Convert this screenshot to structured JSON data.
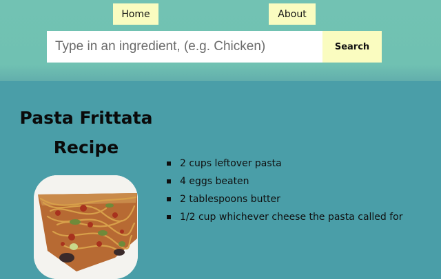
{
  "nav": {
    "home_label": "Home",
    "about_label": "About"
  },
  "search": {
    "placeholder": "Type in an ingredient, (e.g. Chicken)",
    "value": "",
    "button_label": "Search"
  },
  "recipe": {
    "title": "Pasta Frittata Recipe",
    "image_icon": "pasta-frittata-photo",
    "ingredients": [
      "2 cups leftover pasta",
      "4 eggs beaten",
      "2 tablespoons butter",
      "1/2 cup whichever cheese the pasta called for"
    ]
  },
  "colors": {
    "header_bg": "#70c1b2",
    "page_bg": "#4a9ea8",
    "button_bg": "#fafcc0"
  }
}
